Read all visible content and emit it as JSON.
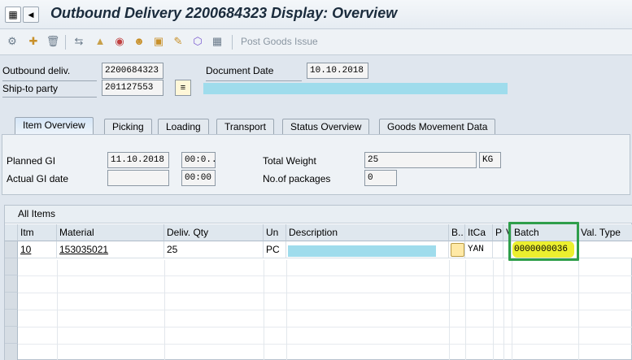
{
  "window": {
    "title": "Outbound Delivery 2200684323 Display: Overview",
    "title_icon": "sap-menu-icon",
    "title_icon2": "sap-collapse-icon"
  },
  "toolbar": {
    "icons": [
      "customize-icon",
      "create-icon",
      "delete-icon",
      "other-document-icon",
      "header-icon",
      "partner-icon",
      "user-icon",
      "text-icon",
      "change-icon",
      "overview-icon"
    ],
    "post_goods_issue": "Post Goods Issue"
  },
  "header": {
    "outbound_delivery_label": "Outbound deliv.",
    "outbound_delivery_value": "2200684323",
    "document_date_label": "Document Date",
    "document_date_value": "10.10.2018",
    "ship_to_label": "Ship-to party",
    "ship_to_value": "201127553"
  },
  "tabs": [
    {
      "label": "Item Overview",
      "active": true
    },
    {
      "label": "Picking",
      "active": false
    },
    {
      "label": "Loading",
      "active": false
    },
    {
      "label": "Transport",
      "active": false
    },
    {
      "label": "Status Overview",
      "active": false
    },
    {
      "label": "Goods Movement Data",
      "active": false
    }
  ],
  "overview": {
    "planned_gi_label": "Planned GI",
    "planned_gi_date": "11.10.2018",
    "planned_gi_time": "00:0...",
    "actual_gi_label": "Actual GI date",
    "actual_gi_date": "",
    "actual_gi_time": "00:00",
    "total_weight_label": "Total Weight",
    "total_weight_value": "25",
    "weight_unit": "KG",
    "packages_label": "No.of packages",
    "packages_value": "0"
  },
  "items": {
    "title": "All Items",
    "columns": [
      "Itm",
      "Material",
      "Deliv. Qty",
      "Un",
      "Description",
      "B..",
      "ItCa",
      "P",
      "V",
      "Batch",
      "Val. Type"
    ],
    "rows": [
      {
        "itm": "10",
        "material": "153035021",
        "qty": "25",
        "un": "PC",
        "description": "",
        "itca": "YAN",
        "batch": "0000000036",
        "val_type": ""
      }
    ]
  },
  "colors": {
    "highlight_yellow": "#ecef2f",
    "annotation_green": "#2e9e4a",
    "redacted_cyan": "#9fdcec"
  }
}
